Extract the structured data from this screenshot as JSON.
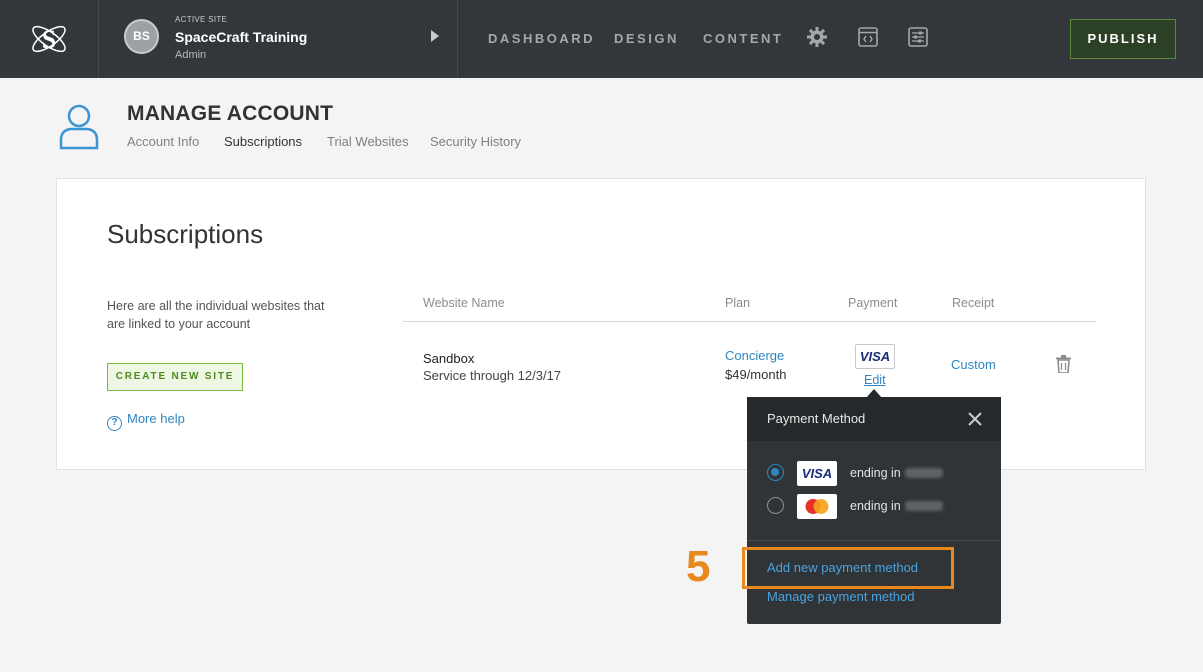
{
  "topbar": {
    "logo_icon": "spacecraft-logo-icon",
    "active_site_label": "ACTIVE SITE",
    "avatar_initials": "BS",
    "site_name": "SpaceCraft Training",
    "site_role": "Admin",
    "nav": [
      "DASHBOARD",
      "DESIGN",
      "CONTENT"
    ],
    "icons": [
      "gear-icon",
      "code-window-icon",
      "sliders-icon"
    ],
    "publish_label": "PUBLISH"
  },
  "header": {
    "title": "MANAGE ACCOUNT",
    "tabs": [
      {
        "label": "Account Info",
        "active": false
      },
      {
        "label": "Subscriptions",
        "active": true
      },
      {
        "label": "Trial Websites",
        "active": false
      },
      {
        "label": "Security History",
        "active": false
      }
    ]
  },
  "subscriptions": {
    "title": "Subscriptions",
    "description": "Here are all the individual websites that are linked to your account",
    "create_button": "CREATE NEW SITE",
    "help_label": "More help",
    "columns": [
      "Website Name",
      "Plan",
      "Payment",
      "Receipt"
    ],
    "rows": [
      {
        "name": "Sandbox",
        "service": "Service through 12/3/17",
        "plan": "Concierge",
        "price": "$49/month",
        "payment_card": "VISA",
        "payment_edit": "Edit",
        "receipt": "Custom"
      }
    ]
  },
  "payment_popover": {
    "title": "Payment Method",
    "methods": [
      {
        "card": "VISA",
        "text": "ending in",
        "selected": true
      },
      {
        "card": "MasterCard",
        "text": "ending in",
        "selected": false
      }
    ],
    "add_link": "Add new payment method",
    "manage_link": "Manage payment method"
  },
  "annotation": {
    "step": "5",
    "color": "#e8891d"
  }
}
